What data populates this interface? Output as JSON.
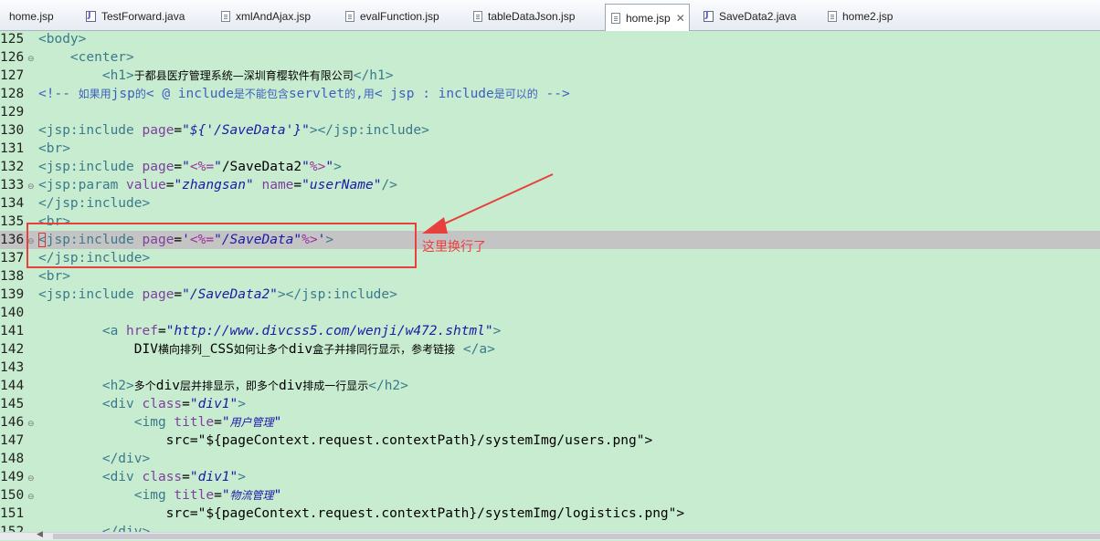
{
  "tabs": [
    {
      "label": "home.jsp",
      "type": "jsp"
    },
    {
      "label": "TestForward.java",
      "type": "java"
    },
    {
      "label": "xmlAndAjax.jsp",
      "type": "jsp"
    },
    {
      "label": "evalFunction.jsp",
      "type": "jsp"
    },
    {
      "label": "tableDataJson.jsp",
      "type": "jsp"
    },
    {
      "label": "home.jsp",
      "type": "jsp",
      "active": true,
      "close": "✕"
    },
    {
      "label": "SaveData2.java",
      "type": "java"
    },
    {
      "label": "home2.jsp",
      "type": "jsp"
    }
  ],
  "editor": {
    "lines": [
      {
        "n": "125",
        "t": "<body>"
      },
      {
        "n": "126",
        "t": "    <center>"
      },
      {
        "n": "127",
        "t": "        <h1>于都县医疗管理系统—深圳育樱软件有限公司</h1>"
      },
      {
        "n": "128",
        "t": "<!-- 如果用jsp的< @ include是不能包含servlet的,用< jsp : include是可以的 -->"
      },
      {
        "n": "129",
        "t": ""
      },
      {
        "n": "130",
        "t": "<jsp:include page=\"${'/SaveData'}\"></jsp:include>"
      },
      {
        "n": "131",
        "t": "<br>"
      },
      {
        "n": "132",
        "t": "<jsp:include page=\"<%=\"/SaveData2\"%>\">"
      },
      {
        "n": "133",
        "t": "<jsp:param value=\"zhangsan\" name=\"userName\"/>"
      },
      {
        "n": "134",
        "t": "</jsp:include>"
      },
      {
        "n": "135",
        "t": "<br>"
      },
      {
        "n": "136",
        "t": "<jsp:include page='<%=\"/SaveData\"%>'>"
      },
      {
        "n": "137",
        "t": "</jsp:include>"
      },
      {
        "n": "138",
        "t": "<br>"
      },
      {
        "n": "139",
        "t": "<jsp:include page=\"/SaveData2\"></jsp:include>"
      },
      {
        "n": "140",
        "t": ""
      },
      {
        "n": "141",
        "t": "        <a href=\"http://www.divcss5.com/wenji/w472.shtml\">"
      },
      {
        "n": "142",
        "t": "            DIV横向排列_CSS如何让多个div盒子并排同行显示，参考链接 </a>"
      },
      {
        "n": "143",
        "t": ""
      },
      {
        "n": "144",
        "t": "        <h2>多个div层并排显示，即多个div排成一行显示</h2>"
      },
      {
        "n": "145",
        "t": "        <div class=\"div1\">"
      },
      {
        "n": "146",
        "t": "            <img title=\"用户管理\""
      },
      {
        "n": "147",
        "t": "                src=\"${pageContext.request.contextPath}/systemImg/users.png\">"
      },
      {
        "n": "148",
        "t": "        </div>"
      },
      {
        "n": "149",
        "t": "        <div class=\"div1\">"
      },
      {
        "n": "150",
        "t": "            <img title=\"物流管理\""
      },
      {
        "n": "151",
        "t": "                src=\"${pageContext.request.contextPath}/systemImg/logistics.png\">"
      },
      {
        "n": "152",
        "t": "        </div>"
      }
    ],
    "current_line": "136",
    "fold_marker": "⊖"
  },
  "annotation": {
    "text": "这里换行了",
    "color": "#e8403c"
  },
  "scrollbar": {
    "left_arrow": "◀"
  }
}
